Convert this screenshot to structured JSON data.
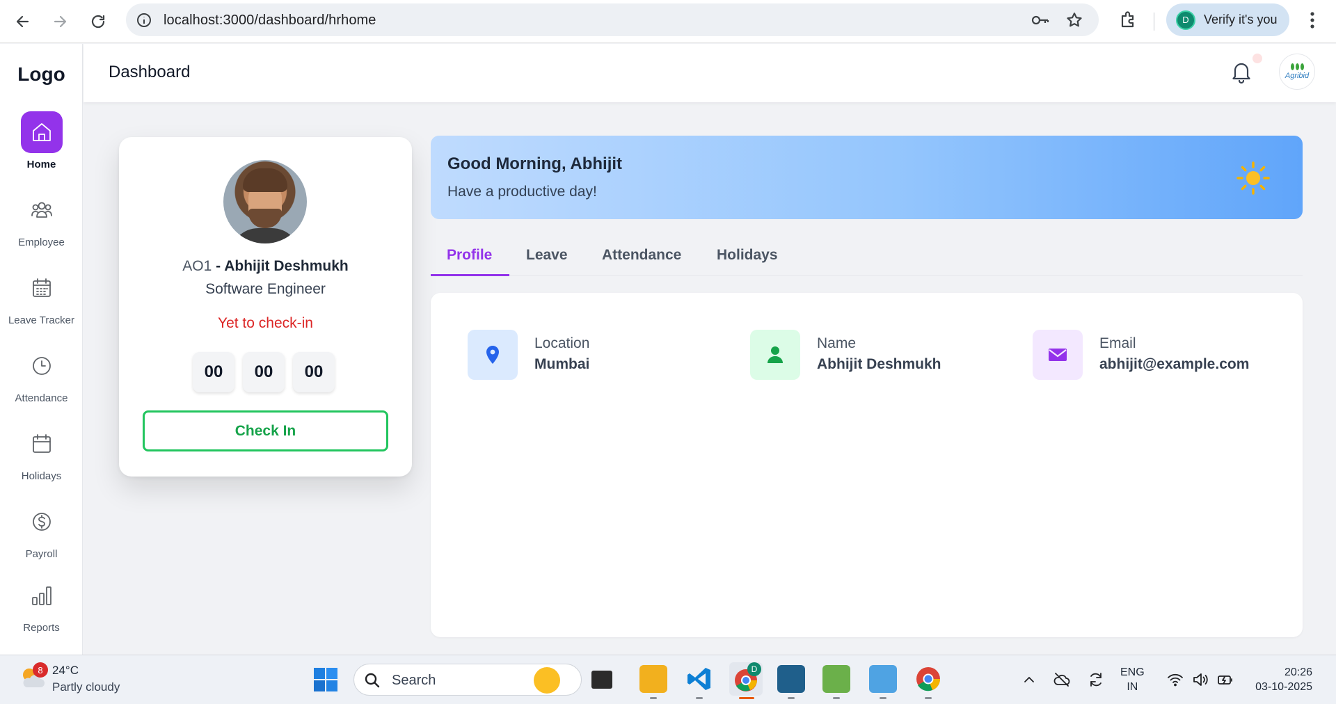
{
  "browser": {
    "url": "localhost:3000/dashboard/hrhome",
    "profile_initial": "D",
    "profile_label": "Verify it's you"
  },
  "sidebar": {
    "logo": "Logo",
    "items": [
      {
        "label": "Home",
        "icon": "home-icon",
        "active": true
      },
      {
        "label": "Employee",
        "icon": "users-icon",
        "active": false
      },
      {
        "label": "Leave Tracker",
        "icon": "calendar-grid-icon",
        "active": false
      },
      {
        "label": "Attendance",
        "icon": "clock-icon",
        "active": false
      },
      {
        "label": "Holidays",
        "icon": "calendar-icon",
        "active": false
      },
      {
        "label": "Payroll",
        "icon": "dollar-icon",
        "active": false
      },
      {
        "label": "Reports",
        "icon": "bar-chart-icon",
        "active": false
      }
    ]
  },
  "header": {
    "title": "Dashboard",
    "org_logo_text": "Agribid"
  },
  "profile_card": {
    "employee_code": "AO1",
    "separator": " - ",
    "name": "Abhijit Deshmukh",
    "role": "Software Engineer",
    "status": "Yet to check-in",
    "timer": {
      "hours": "00",
      "minutes": "00",
      "seconds": "00"
    },
    "check_in_label": "Check In"
  },
  "greeting": {
    "title": "Good Morning, Abhijit",
    "subtitle": "Have a productive day!"
  },
  "tabs": [
    {
      "label": "Profile",
      "active": true
    },
    {
      "label": "Leave",
      "active": false
    },
    {
      "label": "Attendance",
      "active": false
    },
    {
      "label": "Holidays",
      "active": false
    }
  ],
  "profile_info": [
    {
      "label": "Location",
      "value": "Mumbai",
      "icon": "location-pin-icon",
      "color": "#2563eb"
    },
    {
      "label": "Name",
      "value": "Abhijit Deshmukh",
      "icon": "person-icon",
      "color": "#16a34a"
    },
    {
      "label": "Email",
      "value": "abhijit@example.com",
      "icon": "mail-icon",
      "color": "#9333ea"
    }
  ],
  "taskbar": {
    "weather_badge": "8",
    "temperature": "24°C",
    "condition": "Partly cloudy",
    "search_placeholder": "Search",
    "lang_line1": "ENG",
    "lang_line2": "IN",
    "time": "20:26",
    "date": "03-10-2025",
    "chrome_badge": "D"
  },
  "colors": {
    "accent": "#9333ea",
    "success": "#22c55e",
    "danger": "#dc2626"
  }
}
